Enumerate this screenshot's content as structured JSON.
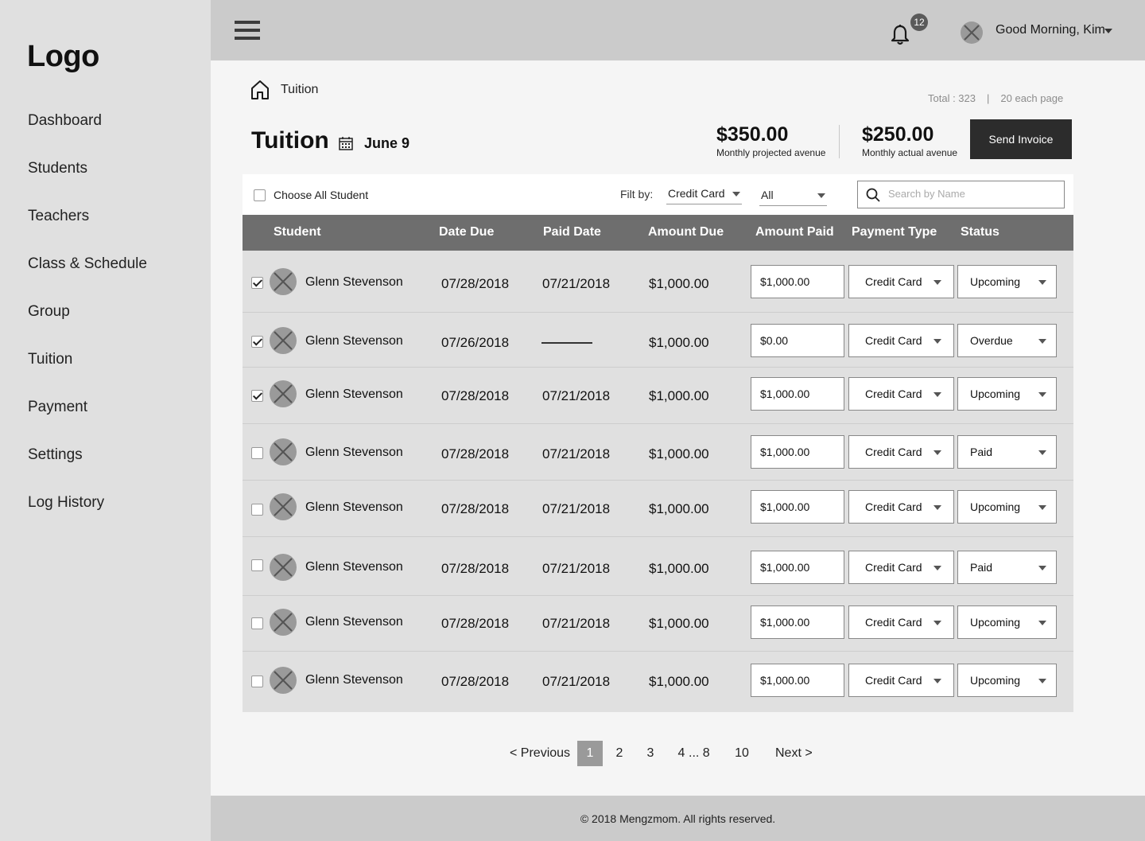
{
  "sidebar": {
    "logo": "Logo",
    "items": [
      {
        "label": "Dashboard"
      },
      {
        "label": "Students"
      },
      {
        "label": "Teachers"
      },
      {
        "label": "Class & Schedule"
      },
      {
        "label": "Group"
      },
      {
        "label": "Tuition"
      },
      {
        "label": "Payment"
      },
      {
        "label": "Settings"
      },
      {
        "label": "Log History"
      }
    ]
  },
  "topbar": {
    "notification_count": "12",
    "greeting": "Good Morning, Kim"
  },
  "breadcrumb": {
    "label": "Tuition"
  },
  "summary": {
    "total": "Total : 323",
    "separator": "|",
    "per_page": "20 each page"
  },
  "header": {
    "title": "Tuition",
    "date": "June 9",
    "projected_value": "$350.00",
    "projected_label": "Monthly projected avenue",
    "actual_value": "$250.00",
    "actual_label": "Monthly actual avenue",
    "send_invoice": "Send Invoice"
  },
  "filters": {
    "choose_all": "Choose All Student",
    "filter_label": "Filt by:",
    "payment_filter": "Credit Card",
    "status_filter": "All",
    "search_placeholder": "Search by Name"
  },
  "table": {
    "columns": {
      "student": "Student",
      "date_due": "Date Due",
      "paid_date": "Paid Date",
      "amount_due": "Amount Due",
      "amount_paid": "Amount Paid",
      "payment_type": "Payment Type",
      "status": "Status"
    },
    "rows": [
      {
        "checked": true,
        "name": "Glenn Stevenson",
        "date_due": "07/28/2018",
        "paid_date": "07/21/2018",
        "amount_due": "$1,000.00",
        "amount_paid": "$1,000.00",
        "payment_type": "Credit Card",
        "status": "Upcoming"
      },
      {
        "checked": true,
        "name": "Glenn Stevenson",
        "date_due": "07/26/2018",
        "paid_date": "",
        "amount_due": "$1,000.00",
        "amount_paid": "$0.00",
        "payment_type": "Credit Card",
        "status": "Overdue"
      },
      {
        "checked": true,
        "name": "Glenn Stevenson",
        "date_due": "07/28/2018",
        "paid_date": "07/21/2018",
        "amount_due": "$1,000.00",
        "amount_paid": "$1,000.00",
        "payment_type": "Credit Card",
        "status": "Upcoming"
      },
      {
        "checked": false,
        "name": "Glenn Stevenson",
        "date_due": "07/28/2018",
        "paid_date": "07/21/2018",
        "amount_due": "$1,000.00",
        "amount_paid": "$1,000.00",
        "payment_type": "Credit Card",
        "status": "Paid"
      },
      {
        "checked": false,
        "name": "Glenn Stevenson",
        "date_due": "07/28/2018",
        "paid_date": "07/21/2018",
        "amount_due": "$1,000.00",
        "amount_paid": "$1,000.00",
        "payment_type": "Credit Card",
        "status": "Upcoming"
      },
      {
        "checked": false,
        "name": "Glenn Stevenson",
        "date_due": "07/28/2018",
        "paid_date": "07/21/2018",
        "amount_due": "$1,000.00",
        "amount_paid": "$1,000.00",
        "payment_type": "Credit Card",
        "status": "Paid"
      },
      {
        "checked": false,
        "name": "Glenn Stevenson",
        "date_due": "07/28/2018",
        "paid_date": "07/21/2018",
        "amount_due": "$1,000.00",
        "amount_paid": "$1,000.00",
        "payment_type": "Credit Card",
        "status": "Upcoming"
      },
      {
        "checked": false,
        "name": "Glenn Stevenson",
        "date_due": "07/28/2018",
        "paid_date": "07/21/2018",
        "amount_due": "$1,000.00",
        "amount_paid": "$1,000.00",
        "payment_type": "Credit Card",
        "status": "Upcoming"
      }
    ]
  },
  "pagination": {
    "previous": "< Previous",
    "pages": [
      "1",
      "2",
      "3",
      "4",
      "... 8",
      "10"
    ],
    "current": "1",
    "next": "Next >"
  },
  "footer": {
    "copyright": "© 2018 Mengzmom. All rights reserved."
  }
}
